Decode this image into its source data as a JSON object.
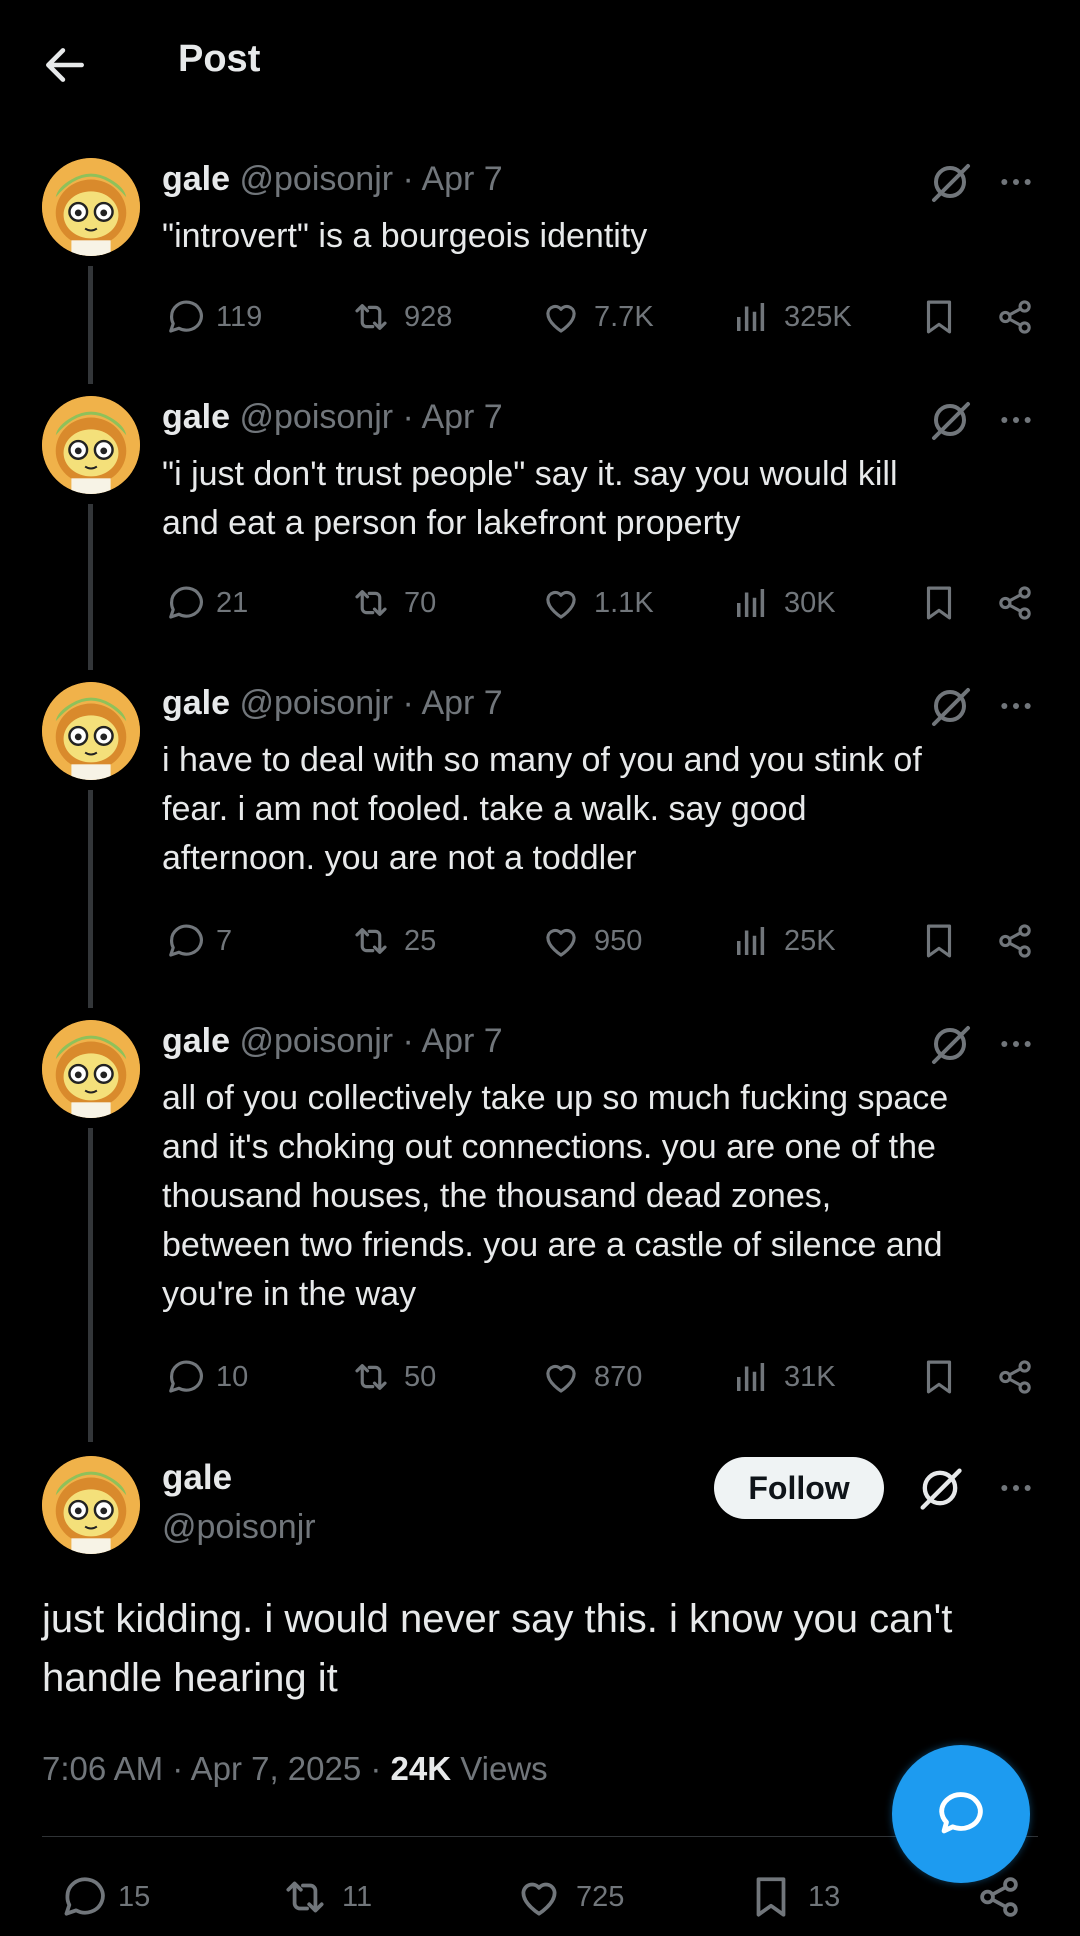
{
  "header": {
    "title": "Post"
  },
  "thread": [
    {
      "name": "gale",
      "handle": "@poisonjr",
      "date": "· Apr 7",
      "lines": [
        "\"introvert\" is a bourgeois identity"
      ],
      "replies": "119",
      "reposts": "928",
      "likes": "7.7K",
      "views": "325K"
    },
    {
      "name": "gale",
      "handle": "@poisonjr",
      "date": "· Apr 7",
      "lines": [
        "\"i just don't trust people\" say it. say you would kill",
        "and eat a person for lakefront property"
      ],
      "replies": "21",
      "reposts": "70",
      "likes": "1.1K",
      "views": "30K"
    },
    {
      "name": "gale",
      "handle": "@poisonjr",
      "date": "· Apr 7",
      "lines": [
        "i have to deal with so many of you and you stink of",
        "fear. i am not fooled. take a walk. say good",
        "afternoon. you are not a toddler"
      ],
      "replies": "7",
      "reposts": "25",
      "likes": "950",
      "views": "25K"
    },
    {
      "name": "gale",
      "handle": "@poisonjr",
      "date": "· Apr 7",
      "lines": [
        "all of you collectively take up so much fucking space",
        "and it's choking out connections. you are one of the",
        "thousand houses, the thousand dead zones,",
        "between two friends. you are a castle of silence and",
        "you're in the way"
      ],
      "replies": "10",
      "reposts": "50",
      "likes": "870",
      "views": "31K"
    }
  ],
  "main": {
    "name": "gale",
    "handle": "@poisonjr",
    "follow_label": "Follow",
    "lines": [
      "just kidding. i would never say this. i know you can't",
      "handle hearing it"
    ],
    "time": "7:06 AM · Apr 7, 2025 · ",
    "views_count": "24K",
    "views_label": " Views",
    "replies": "15",
    "reposts": "11",
    "likes": "725",
    "bookmarks": "13"
  },
  "icons": [
    "back-arrow-icon",
    "grok-icon",
    "more-icon",
    "reply-icon",
    "repost-icon",
    "like-icon",
    "views-icon",
    "bookmark-icon",
    "share-icon",
    "compose-icon"
  ],
  "colors": {
    "background": "#000000",
    "text": "#e7e9ea",
    "secondary": "#71767b",
    "accent": "#1d9bf0",
    "follow_bg": "#eff3f4"
  }
}
